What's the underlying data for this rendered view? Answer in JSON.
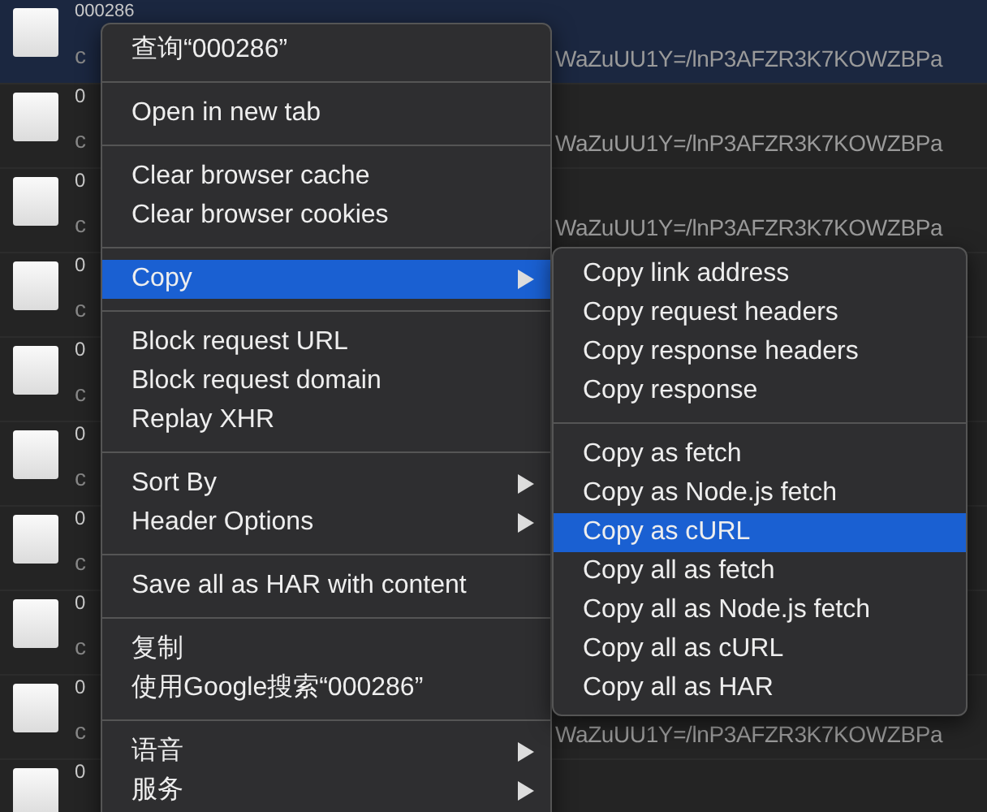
{
  "requests": [
    {
      "name": "000286",
      "detail": "c",
      "url": "WaZuUU1Y=/lnP3AFZR3K7KOWZBPa",
      "selected": true
    },
    {
      "name": "0",
      "detail": "c",
      "url": "WaZuUU1Y=/lnP3AFZR3K7KOWZBPa",
      "selected": false
    },
    {
      "name": "0",
      "detail": "c",
      "url": "WaZuUU1Y=/lnP3AFZR3K7KOWZBPa",
      "selected": false
    },
    {
      "name": "0",
      "detail": "c",
      "selected": false
    },
    {
      "name": "0",
      "detail": "c",
      "selected": false
    },
    {
      "name": "0",
      "detail": "c",
      "selected": false
    },
    {
      "name": "0",
      "detail": "c",
      "selected": false
    },
    {
      "name": "0",
      "detail": "c",
      "selected": false
    },
    {
      "name": "0",
      "detail": "c",
      "url": "WaZuUU1Y=/lnP3AFZR3K7KOWZBPa",
      "selected": false
    },
    {
      "name": "0",
      "selected": false
    }
  ],
  "context_menu": {
    "groups": [
      [
        {
          "label": "查询“000286”",
          "submenu": false,
          "selected": false
        }
      ],
      [
        {
          "label": "Open in new tab",
          "submenu": false,
          "selected": false
        }
      ],
      [
        {
          "label": "Clear browser cache",
          "submenu": false,
          "selected": false
        },
        {
          "label": "Clear browser cookies",
          "submenu": false,
          "selected": false
        }
      ],
      [
        {
          "label": "Copy",
          "submenu": true,
          "selected": true
        }
      ],
      [
        {
          "label": "Block request URL",
          "submenu": false,
          "selected": false
        },
        {
          "label": "Block request domain",
          "submenu": false,
          "selected": false
        },
        {
          "label": "Replay XHR",
          "submenu": false,
          "selected": false
        }
      ],
      [
        {
          "label": "Sort By",
          "submenu": true,
          "selected": false
        },
        {
          "label": "Header Options",
          "submenu": true,
          "selected": false
        }
      ],
      [
        {
          "label": "Save all as HAR with content",
          "submenu": false,
          "selected": false
        }
      ],
      [
        {
          "label": "复制",
          "submenu": false,
          "selected": false
        },
        {
          "label": "使用Google搜索“000286”",
          "submenu": false,
          "selected": false
        }
      ],
      [
        {
          "label": "语音",
          "submenu": true,
          "selected": false
        },
        {
          "label": "服务",
          "submenu": true,
          "selected": false
        }
      ]
    ]
  },
  "copy_submenu": {
    "groups": [
      [
        {
          "label": "Copy link address",
          "selected": false
        },
        {
          "label": "Copy request headers",
          "selected": false
        },
        {
          "label": "Copy response headers",
          "selected": false
        },
        {
          "label": "Copy response",
          "selected": false
        }
      ],
      [
        {
          "label": "Copy as fetch",
          "selected": false
        },
        {
          "label": "Copy as Node.js fetch",
          "selected": false
        },
        {
          "label": "Copy as cURL",
          "selected": true
        },
        {
          "label": "Copy all as fetch",
          "selected": false
        },
        {
          "label": "Copy all as Node.js fetch",
          "selected": false
        },
        {
          "label": "Copy all as cURL",
          "selected": false
        },
        {
          "label": "Copy all as HAR",
          "selected": false
        }
      ]
    ]
  }
}
